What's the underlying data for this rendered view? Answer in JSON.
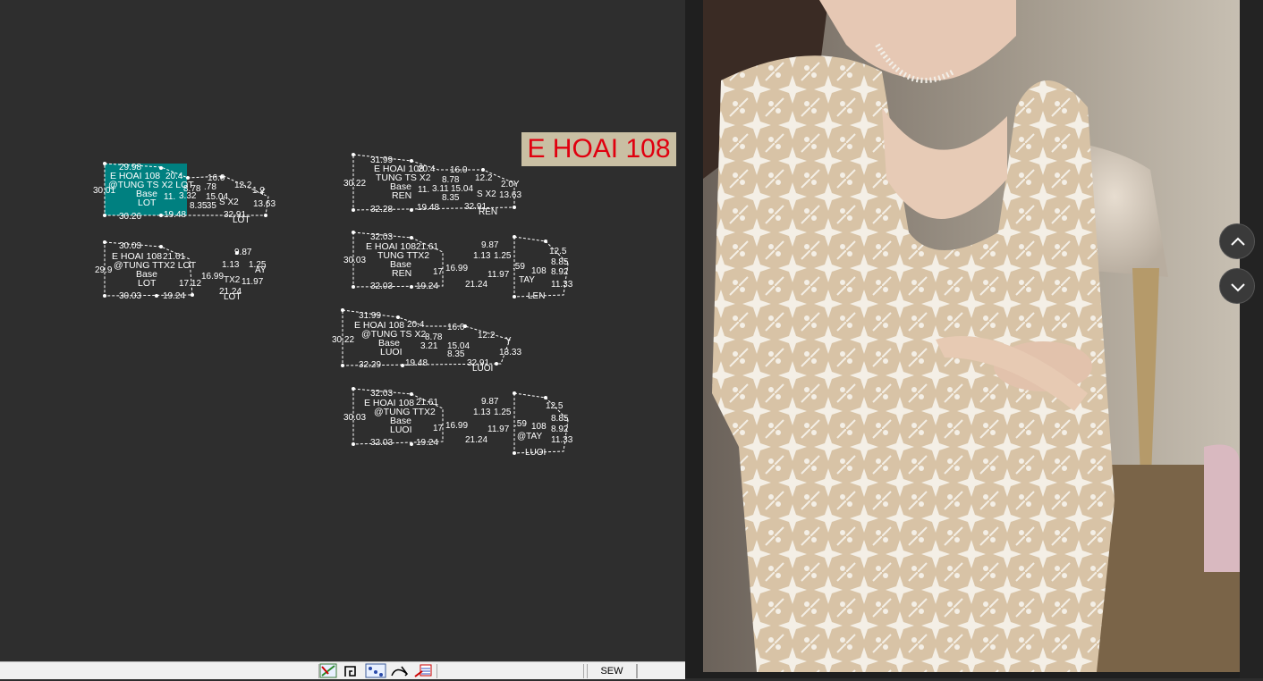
{
  "canvas": {
    "tag_label": "E HOAI 108",
    "pieces": [
      {
        "name": "E HOAI 108",
        "line2": "@TUNG TS X2 LOT",
        "base": "Base",
        "fabric": "LOT",
        "top": "29.98",
        "bottom": "30.26",
        "left": "30.01"
      },
      {
        "name": "E HOAI 108",
        "line2": "@TUNG TTX2 LOT",
        "base": "Base",
        "fabric": "LOT",
        "top": "30.03",
        "bottom": "30.03",
        "left": "29.9"
      },
      {
        "name": "E HOAI 108",
        "line2": "TUNG TS X2",
        "base": "Base",
        "fabric": "REN",
        "top": "31.99",
        "bottom": "32.28",
        "left": "30.22"
      },
      {
        "name": "E HOAI 108",
        "line2": "TUNG TTX2",
        "base": "Base",
        "fabric": "REN",
        "top": "32.03",
        "bottom": "32.03",
        "left": "30.03"
      },
      {
        "name": "E HOAI 108",
        "line2": "@TUNG TS X2",
        "base": "Base",
        "fabric": "LUOI",
        "top": "31.99",
        "bottom": "32.29",
        "left": "30.22"
      },
      {
        "name": "E HOAI 108",
        "line2": "@TUNG TTX2",
        "base": "Base",
        "fabric": "LUOI",
        "top": "32.03",
        "bottom": "32.03",
        "left": "30.03"
      }
    ]
  },
  "statusbar": {
    "mode_label": "SEW",
    "icons": [
      "measure-icon",
      "seam-icon",
      "grade-icon",
      "pen-icon",
      "stack-icon"
    ]
  },
  "viewer": {
    "prev_icon": "chevron-up-icon",
    "next_icon": "chevron-down-icon"
  }
}
